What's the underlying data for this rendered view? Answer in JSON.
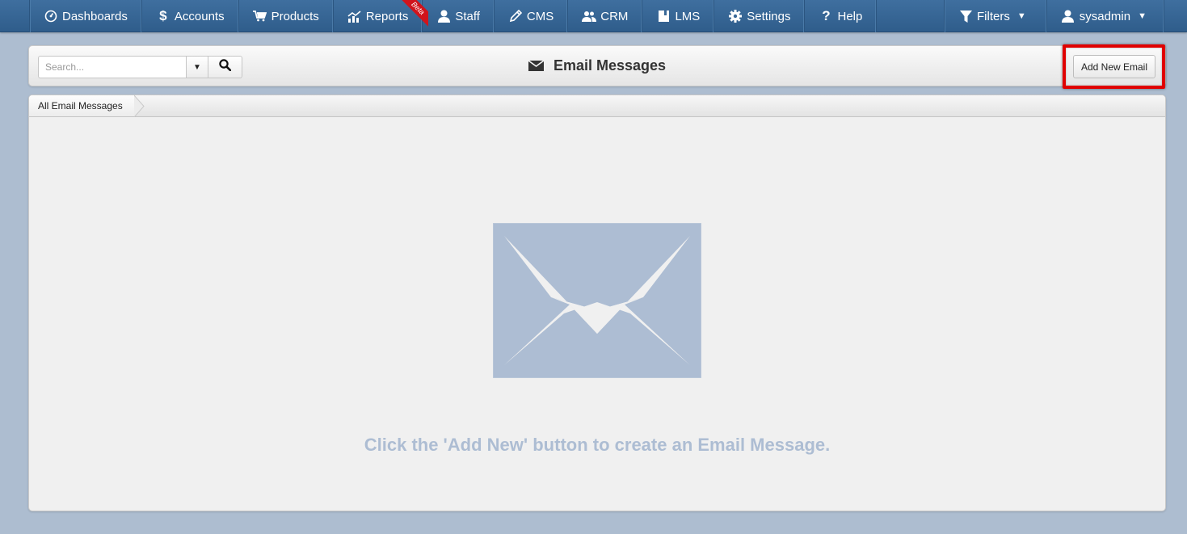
{
  "nav": {
    "items": [
      {
        "label": "Dashboards",
        "icon": "dashboard-icon"
      },
      {
        "label": "Accounts",
        "icon": "dollar-icon"
      },
      {
        "label": "Products",
        "icon": "cart-icon"
      },
      {
        "label": "Reports",
        "icon": "chart-icon",
        "badge": "Beta"
      },
      {
        "label": "Staff",
        "icon": "user-icon"
      },
      {
        "label": "CMS",
        "icon": "pencil-icon"
      },
      {
        "label": "CRM",
        "icon": "users-icon"
      },
      {
        "label": "LMS",
        "icon": "book-icon"
      },
      {
        "label": "Settings",
        "icon": "gear-icon"
      },
      {
        "label": "Help",
        "icon": "question-icon"
      }
    ],
    "filters_label": "Filters",
    "user_label": "sysadmin"
  },
  "header": {
    "search_placeholder": "Search...",
    "title": "Email Messages",
    "add_button_label": "Add New Email"
  },
  "breadcrumb": {
    "label": "All Email Messages"
  },
  "empty_state": {
    "message": "Click the 'Add New' button to create an Email Message."
  },
  "colors": {
    "nav_bg": "#3a6998",
    "page_bg": "#adbdd0",
    "highlight": "#e00000",
    "illustration": "#adbdd3"
  }
}
